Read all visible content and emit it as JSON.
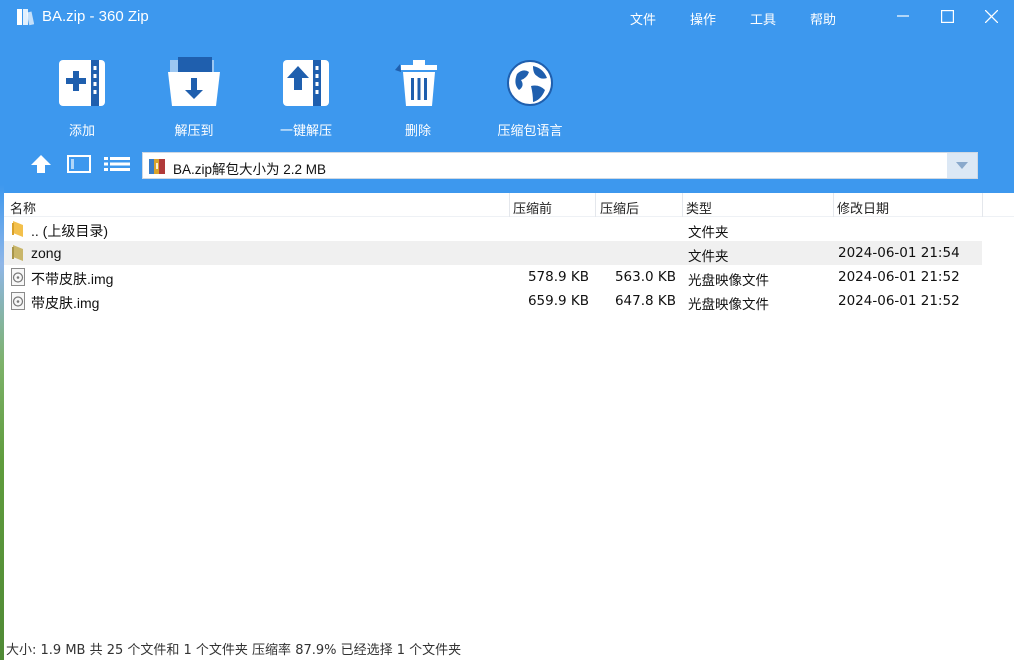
{
  "window": {
    "title": "BA.zip - 360 Zip"
  },
  "menu": {
    "file": "文件",
    "operate": "操作",
    "tools": "工具",
    "help": "帮助"
  },
  "toolbar": {
    "add": "添加",
    "extract_to": "解压到",
    "one_click_extract": "一键解压",
    "delete": "删除",
    "archive_language": "压缩包语言"
  },
  "path": {
    "text": "BA.zip解包大小为 2.2 MB"
  },
  "columns": {
    "name": "名称",
    "before": "压缩前",
    "after": "压缩后",
    "type": "类型",
    "modified": "修改日期"
  },
  "rows": [
    {
      "name": ".. (上级目录)",
      "before": "",
      "after": "",
      "type": "文件夹",
      "modified": "",
      "icon": "folder-icon"
    },
    {
      "name": "zong",
      "before": "",
      "after": "",
      "type": "文件夹",
      "modified": "2024-06-01 21:54",
      "icon": "folder-icon"
    },
    {
      "name": "不带皮肤.img",
      "before": "578.9 KB",
      "after": "563.0 KB",
      "type": "光盘映像文件",
      "modified": "2024-06-01 21:52",
      "icon": "disc-image-icon"
    },
    {
      "name": "带皮肤.img",
      "before": "659.9 KB",
      "after": "647.8 KB",
      "type": "光盘映像文件",
      "modified": "2024-06-01 21:52",
      "icon": "disc-image-icon"
    }
  ],
  "status": {
    "text": "大小: 1.9 MB 共 25 个文件和 1 个文件夹 压缩率 87.9% 已经选择 1 个文件夹"
  },
  "colors": {
    "header_blue": "#3d98ee",
    "selected_row": "#f0f0f0"
  }
}
